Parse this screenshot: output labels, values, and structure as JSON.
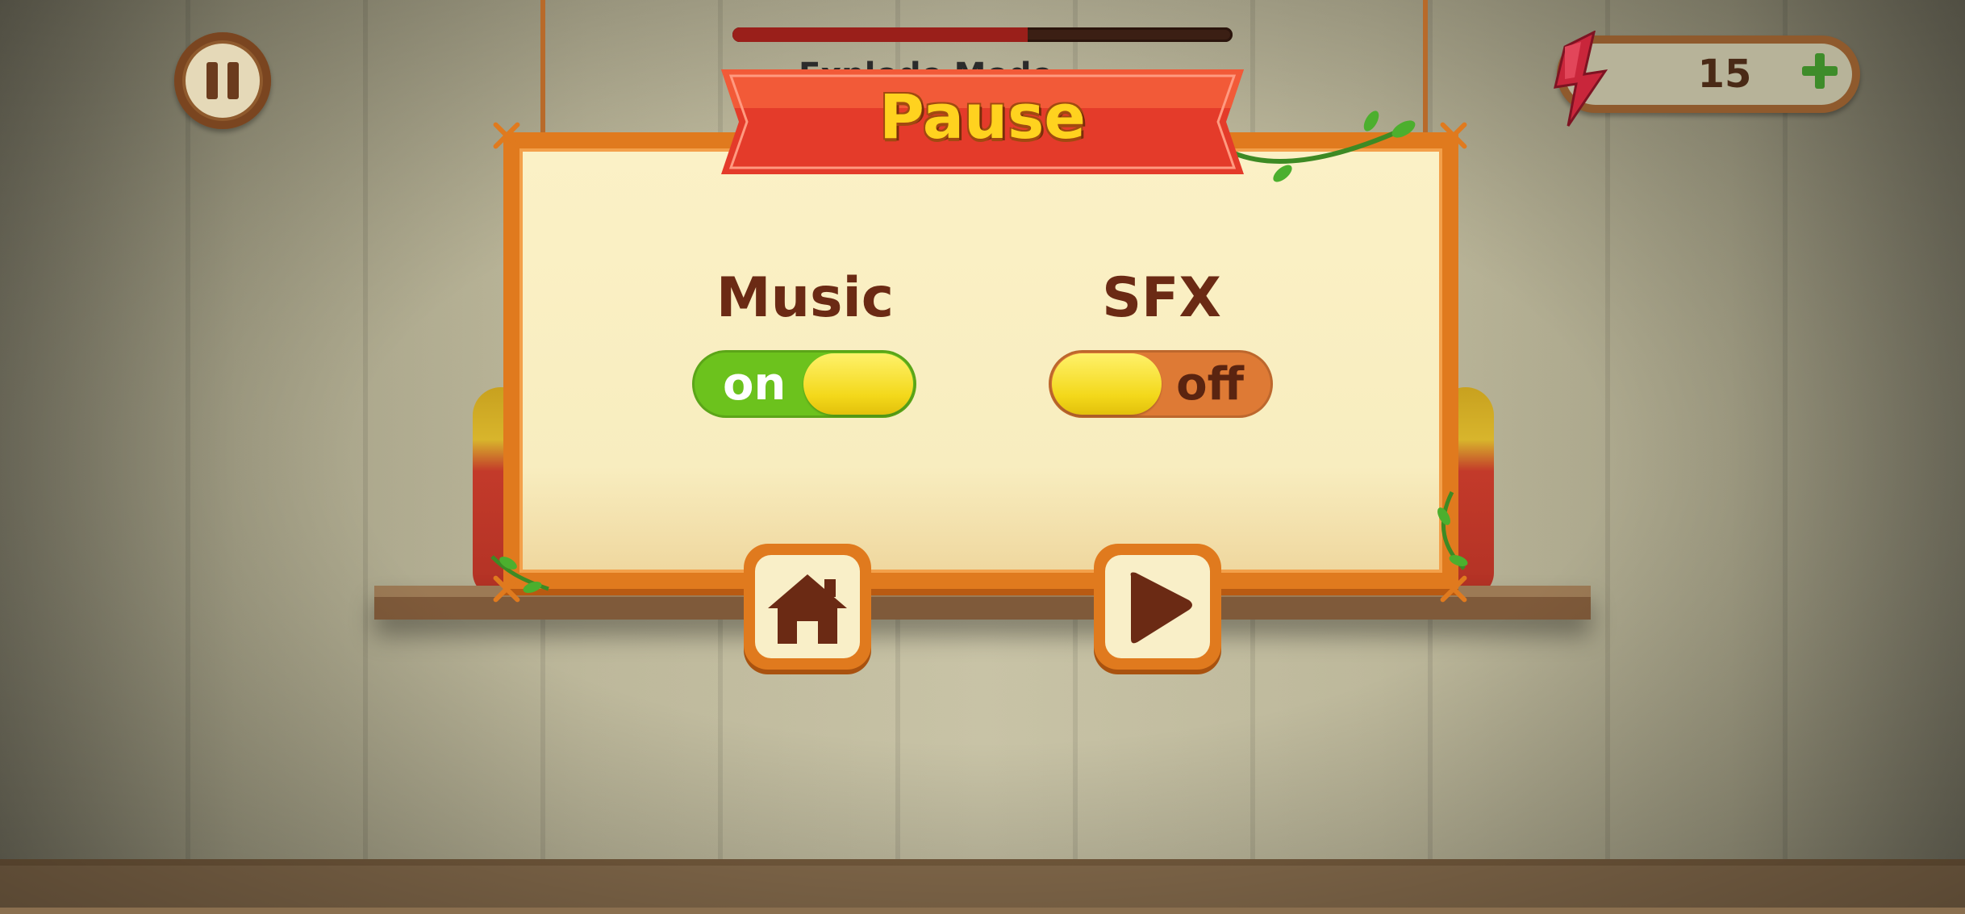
{
  "hud": {
    "pause_icon": "pause-icon",
    "progress_fraction": 0.59,
    "behind_title": "Explode Mode",
    "currency": {
      "icon": "red-lightning-gem-icon",
      "count": "15",
      "add_icon": "plus-icon"
    }
  },
  "dialog": {
    "title": "Pause",
    "music": {
      "label": "Music",
      "state": "on"
    },
    "sfx": {
      "label": "SFX",
      "state": "off"
    },
    "buttons": {
      "home_icon": "home-icon",
      "play_icon": "play-icon"
    }
  },
  "colors": {
    "frame": "#e07a1e",
    "ribbon": "#e43b2a",
    "title_text": "#ffd21f",
    "toggle_on": "#6cc21d",
    "toggle_off": "#de7a35",
    "knob": "#f3d81a",
    "label_text": "#6b2a14"
  }
}
